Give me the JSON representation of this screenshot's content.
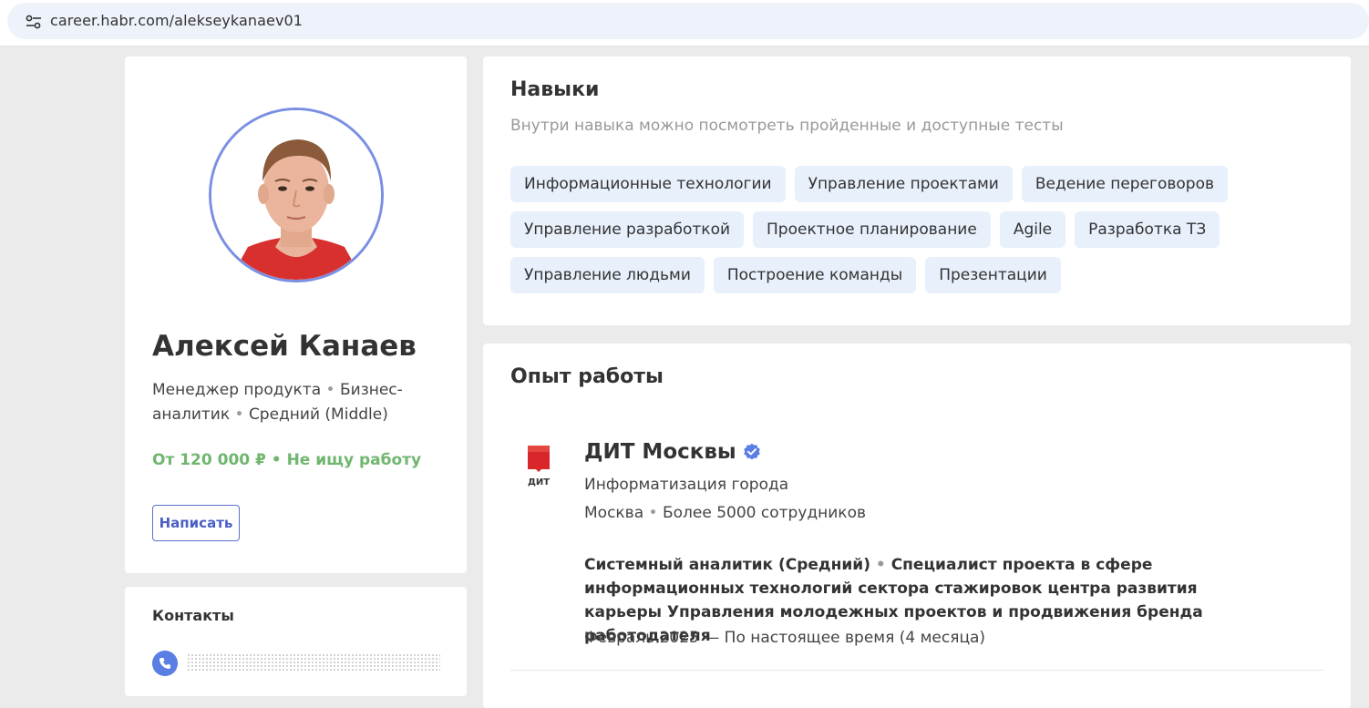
{
  "browser": {
    "url": "career.habr.com/alekseykanaev01",
    "icon": "tune-icon"
  },
  "profile": {
    "name": "Алексей Канаев",
    "specialization_part1": "Менеджер продукта",
    "specialization_part2": "Бизнес-аналитик",
    "specialization_part3": "Средний (Middle)",
    "separator": "•",
    "salary": "От 120 000 ₽ • Не ищу работу",
    "write_button": "Написать",
    "accent_color": "#7a8fe4",
    "salary_color": "#6fb66f"
  },
  "contacts": {
    "title": "Контакты",
    "phone_icon": "phone-icon"
  },
  "skills": {
    "title": "Навыки",
    "hint": "Внутри навыка можно посмотреть пройденные и доступные тесты",
    "rows": [
      [
        "Информационные технологии",
        "Управление проектами",
        "Ведение переговоров"
      ],
      [
        "Управление разработкой",
        "Проектное планирование",
        "Agile",
        "Разработка ТЗ"
      ],
      [
        "Управление людьми",
        "Построение команды",
        "Презентации"
      ]
    ]
  },
  "experience": {
    "title": "Опыт работы",
    "items": [
      {
        "logo_text": "ДИТ",
        "company": "ДИТ Москвы",
        "industry": "Информатизация города",
        "city": "Москва",
        "size": "Более 5000 сотрудников",
        "position_title": "Системный аналитик (Средний)",
        "position_desc": "Специалист проекта в сфере информационных технологий сектора стажировок центра развития карьеры Управления молодежных проектов и продвижения бренда работодателя",
        "period": "Февраль 2025 — По настоящее время (4 месяца)"
      }
    ]
  }
}
